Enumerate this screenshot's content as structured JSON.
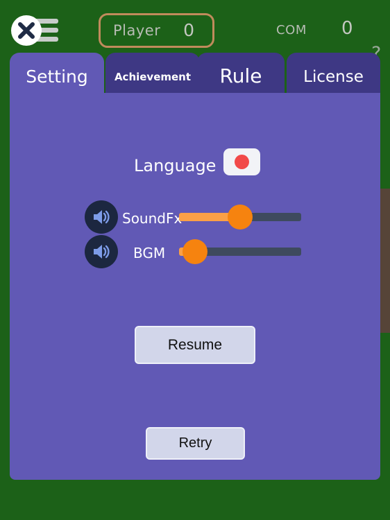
{
  "theme": {
    "background_green": "#1c6118",
    "panel_purple": "#6159b5",
    "tab_inactive": "#3e3884",
    "accent_orange": "#f6830f",
    "slider_fill": "#fba046",
    "slider_track": "#3e4a5e",
    "button_face": "#d2d6ea",
    "player_box_border": "#c08b5c",
    "brown_strip": "#564438",
    "flag_red": "#f24949"
  },
  "header": {
    "menu_icon": "close-x-icon",
    "hamburger_icon": "hamburger-icon",
    "player": {
      "label": "Player",
      "score": "0"
    },
    "com": {
      "label": "COM",
      "score": "0"
    },
    "help_glyph": "?"
  },
  "tabs": [
    {
      "id": "setting",
      "label": "Setting",
      "active": true
    },
    {
      "id": "achievement",
      "label": "Achievement",
      "active": false
    },
    {
      "id": "rule",
      "label": "Rule",
      "active": false
    },
    {
      "id": "license",
      "label": "License",
      "active": false
    }
  ],
  "settings": {
    "language": {
      "label": "Language",
      "value_icon": "japan-flag-icon",
      "value": "Japanese"
    },
    "sliders": [
      {
        "id": "soundfx",
        "label": "SoundFx",
        "icon": "speaker-icon",
        "value": 50,
        "min": 0,
        "max": 100
      },
      {
        "id": "bgm",
        "label": "BGM",
        "icon": "speaker-icon",
        "value": 13,
        "min": 0,
        "max": 100
      }
    ],
    "buttons": {
      "resume": "Resume",
      "retry": "Retry"
    }
  }
}
